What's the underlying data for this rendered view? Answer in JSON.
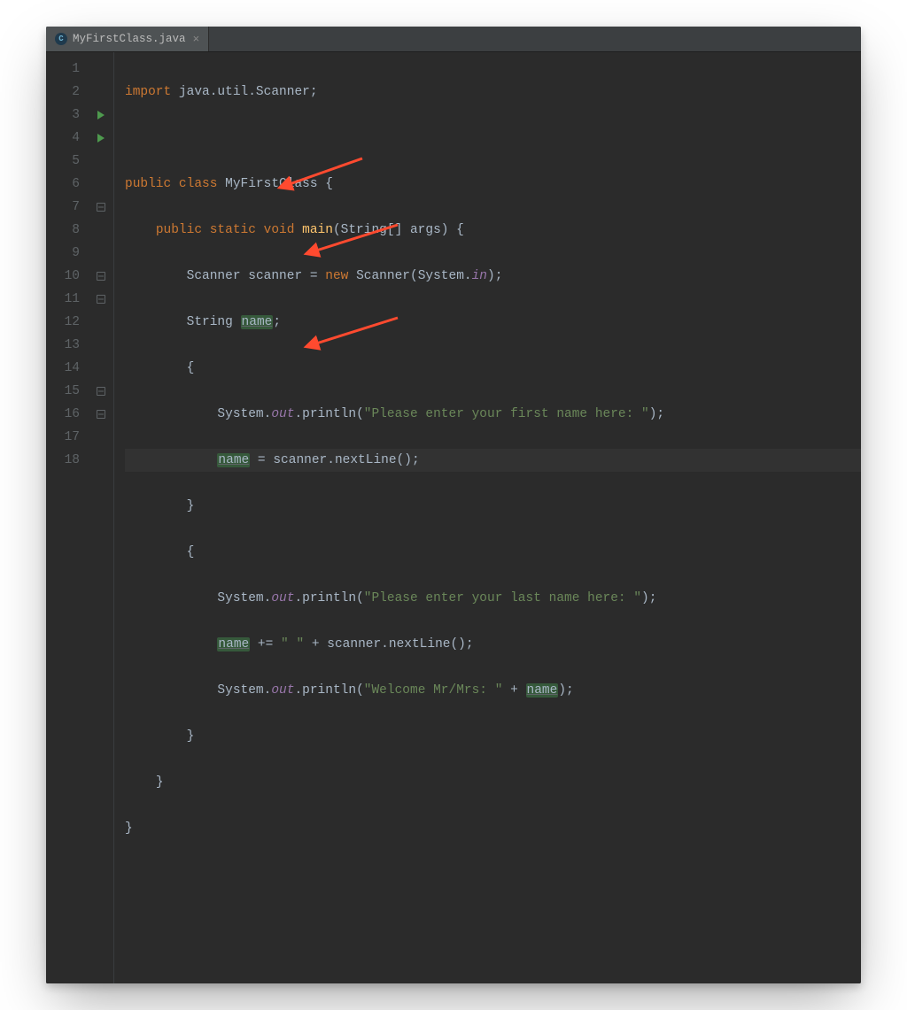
{
  "tab": {
    "filename": "MyFirstClass.java",
    "close": "×"
  },
  "lineNumbers": [
    "1",
    "2",
    "3",
    "4",
    "5",
    "6",
    "7",
    "8",
    "9",
    "10",
    "11",
    "12",
    "13",
    "14",
    "15",
    "16",
    "17",
    "18"
  ],
  "currentLine": 9,
  "code": {
    "l1": {
      "kw1": "import",
      "rest": " java.util.Scanner;"
    },
    "l3": {
      "kw1": "public class ",
      "cls": "MyFirstClass",
      "rest": " {"
    },
    "l4": {
      "kw1": "public static void ",
      "fn": "main",
      "rest1": "(String[] args) {"
    },
    "l5": {
      "t1": "Scanner scanner = ",
      "kw": "new",
      "t2": " Scanner(System.",
      "it": "in",
      "t3": ");"
    },
    "l6": {
      "t1": "String ",
      "u": "name",
      "t2": ";"
    },
    "l7": {
      "t": "{"
    },
    "l8": {
      "t1": "System.",
      "it": "out",
      "t2": ".println(",
      "str": "\"Please enter your first name here: \"",
      "t3": ");"
    },
    "l9": {
      "u": "name",
      "t1": " = scanner.nextLine();"
    },
    "l10": {
      "t": "}"
    },
    "l11": {
      "t": "{"
    },
    "l12": {
      "t1": "System.",
      "it": "out",
      "t2": ".println(",
      "str": "\"Please enter your last name here: \"",
      "t3": ");"
    },
    "l13": {
      "u": "name",
      "t1": " += ",
      "str": "\" \"",
      "t2": " + scanner.nextLine();"
    },
    "l14": {
      "t1": "System.",
      "it": "out",
      "t2": ".println(",
      "str": "\"Welcome Mr/Mrs: \"",
      "t3": " + ",
      "u": "name",
      "t4": ");"
    },
    "l15": {
      "t": "}"
    },
    "l16": {
      "t": "}"
    },
    "l17": {
      "t": "}"
    }
  },
  "colors": {
    "arrow": "#ff4a2f"
  }
}
